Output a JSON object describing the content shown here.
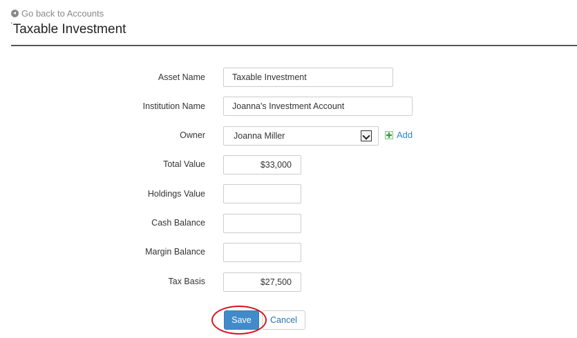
{
  "nav": {
    "back_label": "Go back to Accounts"
  },
  "page": {
    "title": "Taxable Investment"
  },
  "form": {
    "asset_name": {
      "label": "Asset Name",
      "value": "Taxable Investment"
    },
    "institution_name": {
      "label": "Institution Name",
      "value": "Joanna's Investment Account"
    },
    "owner": {
      "label": "Owner",
      "value": "Joanna Miller",
      "add_label": "Add"
    },
    "total_value": {
      "label": "Total Value",
      "value": "$33,000"
    },
    "holdings_value": {
      "label": "Holdings Value",
      "value": ""
    },
    "cash_balance": {
      "label": "Cash Balance",
      "value": ""
    },
    "margin_balance": {
      "label": "Margin Balance",
      "value": ""
    },
    "tax_basis": {
      "label": "Tax Basis",
      "value": "$27,500"
    }
  },
  "actions": {
    "save_label": "Save",
    "cancel_label": "Cancel"
  },
  "icons": {
    "back": "arrow-circle-left-icon",
    "add": "plus-square-icon",
    "select": "chevron-down-icon"
  },
  "colors": {
    "primary": "#428bca",
    "link": "#2a88c8",
    "highlight": "#d9141c",
    "add_icon": "#2e9b2e"
  }
}
